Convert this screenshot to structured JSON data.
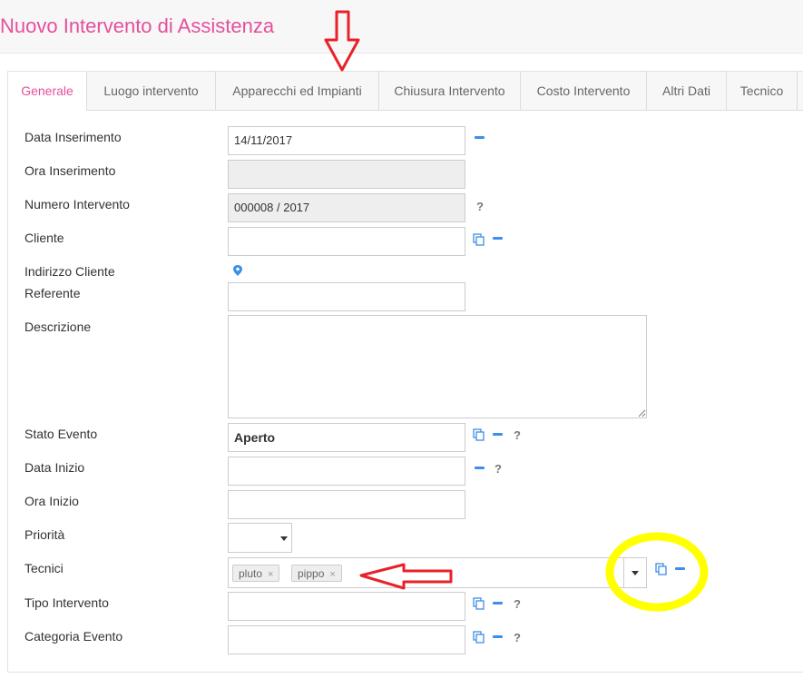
{
  "page": {
    "title": "Nuovo Intervento di Assistenza"
  },
  "tabs": [
    {
      "label": "Generale",
      "active": true
    },
    {
      "label": "Luogo intervento"
    },
    {
      "label": "Apparecchi ed Impianti"
    },
    {
      "label": "Chiusura Intervento"
    },
    {
      "label": "Costo Intervento"
    },
    {
      "label": "Altri Dati"
    },
    {
      "label": "Tecnico"
    }
  ],
  "form": {
    "data_inserimento": {
      "label": "Data Inserimento",
      "value": "14/11/2017"
    },
    "ora_inserimento": {
      "label": "Ora Inserimento",
      "value": ""
    },
    "numero_intervento": {
      "label": "Numero Intervento",
      "value": "000008 / 2017"
    },
    "cliente": {
      "label": "Cliente",
      "value": ""
    },
    "indirizzo_cliente": {
      "label": "Indirizzo Cliente"
    },
    "referente": {
      "label": "Referente",
      "value": ""
    },
    "descrizione": {
      "label": "Descrizione",
      "value": ""
    },
    "stato_evento": {
      "label": "Stato Evento",
      "value": "Aperto"
    },
    "data_inizio": {
      "label": "Data Inizio",
      "value": ""
    },
    "ora_inizio": {
      "label": "Ora Inizio",
      "value": ""
    },
    "priorita": {
      "label": "Priorità",
      "value": ""
    },
    "tecnici": {
      "label": "Tecnici",
      "tags": [
        "pluto",
        "pippo"
      ]
    },
    "tipo_intervento": {
      "label": "Tipo Intervento",
      "value": ""
    },
    "categoria_evento": {
      "label": "Categoria Evento",
      "value": ""
    }
  },
  "icons": {
    "help_glyph": "?",
    "remove_glyph": "×"
  },
  "colors": {
    "accent": "#e4509b",
    "icon_blue": "#3d8ee6",
    "annotation_red": "#e8212a",
    "annotation_yellow": "#ffff00"
  }
}
